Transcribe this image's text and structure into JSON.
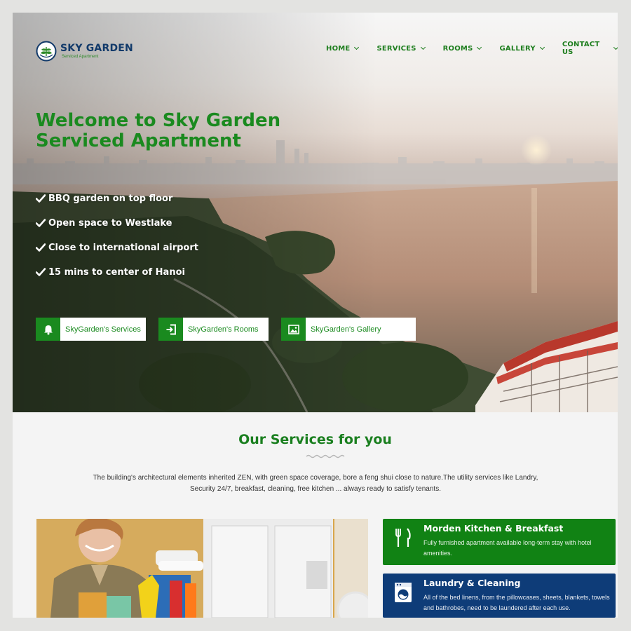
{
  "brand": {
    "name": "SKY GARDEN",
    "tagline": "Serviced Apartment",
    "icon": "leaf-logo-icon"
  },
  "nav": [
    {
      "label": "HOME"
    },
    {
      "label": "SERVICES"
    },
    {
      "label": "ROOMS"
    },
    {
      "label": "GALLERY"
    },
    {
      "label": "CONTACT US"
    }
  ],
  "hero": {
    "title_line1": "Welcome to Sky Garden",
    "title_line2": "Serviced Apartment",
    "features": [
      "BBQ garden on top floor",
      "Open space to Westlake",
      "Close to international airport",
      "15 mins to center of Hanoi"
    ],
    "buttons": [
      {
        "label": "SkyGarden's Services",
        "icon": "bell-icon"
      },
      {
        "label": "SkyGarden's Rooms",
        "icon": "door-enter-icon"
      },
      {
        "label": "SkyGarden's Gallery",
        "icon": "picture-icon"
      }
    ]
  },
  "services": {
    "heading": "Our Services for you",
    "description": "The building's architectural elements inherited ZEN, with green space coverage, bore a feng shui close to nature.The utility services like Landry, Security 24/7, breakfast, cleaning, free kitchen ... always ready to satisfy tenants.",
    "cards": [
      {
        "title": "Morden Kitchen & Breakfast",
        "text": "Fully furnished apartment available long-term stay with hotel amenities.",
        "icon": "fork-knife-icon",
        "color": "#118214"
      },
      {
        "title": "Laundry & Cleaning",
        "text": "All of the bed linens, from the pillowcases, sheets, blankets, towels and bathrobes, need to be laundered after each use.",
        "icon": "washing-machine-icon",
        "color": "#0e3c78"
      }
    ]
  },
  "colors": {
    "primary_green": "#1a8a1f",
    "navy": "#123a6a",
    "card_blue": "#0e3c78"
  }
}
